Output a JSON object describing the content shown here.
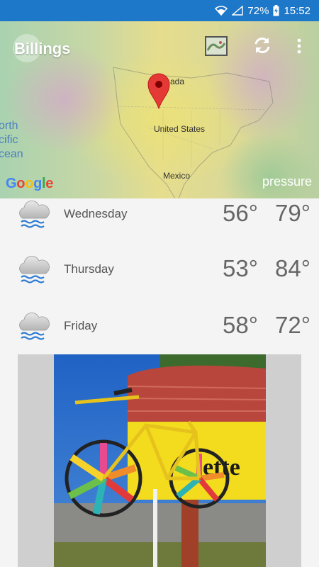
{
  "status": {
    "battery": "72%",
    "time": "15:52"
  },
  "header": {
    "city": "Billings",
    "overlay_label": "pressure"
  },
  "map": {
    "labels": {
      "canada": "ada",
      "us": "United States",
      "mexico": "Mexico"
    },
    "ocean_lines": [
      "orth",
      "cific",
      "cean"
    ],
    "attribution": "Google"
  },
  "forecast": [
    {
      "day": "Wednesday",
      "low": "56°",
      "high": "79°",
      "icon": "rain-cloud-icon"
    },
    {
      "day": "Thursday",
      "low": "53°",
      "high": "84°",
      "icon": "rain-cloud-icon"
    },
    {
      "day": "Friday",
      "low": "58°",
      "high": "72°",
      "icon": "rain-cloud-icon"
    }
  ],
  "colors": {
    "status_bar": "#1d78c9",
    "text": "#666666",
    "rain": "#2c7bd6"
  }
}
